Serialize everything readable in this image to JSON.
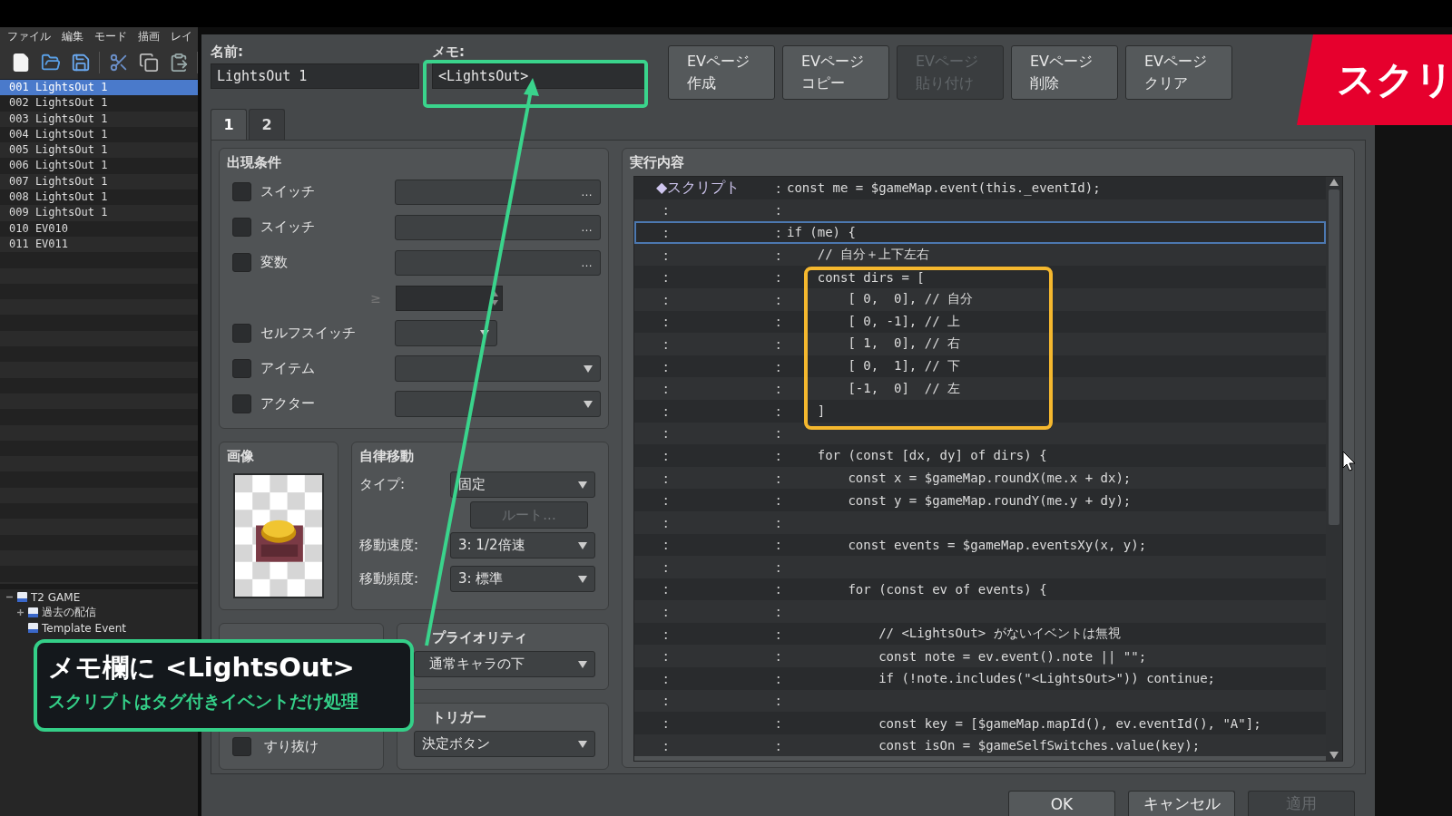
{
  "menu": [
    "ファイル",
    "編集",
    "モード",
    "描画",
    "レイ"
  ],
  "event_list": [
    {
      "text": "001 LightsOut 1",
      "selected": true
    },
    {
      "text": "002 LightsOut 1",
      "selected": false
    },
    {
      "text": "003 LightsOut 1",
      "selected": false
    },
    {
      "text": "004 LightsOut 1",
      "selected": false
    },
    {
      "text": "005 LightsOut 1",
      "selected": false
    },
    {
      "text": "006 LightsOut 1",
      "selected": false
    },
    {
      "text": "007 LightsOut 1",
      "selected": false
    },
    {
      "text": "008 LightsOut 1",
      "selected": false
    },
    {
      "text": "009 LightsOut 1",
      "selected": false
    },
    {
      "text": "010 EV010",
      "selected": false
    },
    {
      "text": "011 EV011",
      "selected": false
    }
  ],
  "tree": {
    "label": "T2 GAME",
    "expanded": true,
    "children": [
      {
        "label": "過去の配信",
        "expanded": false
      },
      {
        "label": "Template Event"
      }
    ]
  },
  "dialog": {
    "name_label": "名前:",
    "name_value": "LightsOut 1",
    "memo_label": "メモ:",
    "memo_value": "<LightsOut>",
    "page_buttons": [
      {
        "label": "EVページ作成",
        "disabled": false
      },
      {
        "label": "EVページコピー",
        "disabled": false
      },
      {
        "label": "EVページ貼り付け",
        "disabled": true
      },
      {
        "label": "EVページ削除",
        "disabled": false
      },
      {
        "label": "EVページクリア",
        "disabled": false
      }
    ],
    "tabs": [
      {
        "label": "1",
        "selected": true
      },
      {
        "label": "2",
        "selected": false
      }
    ],
    "conditions": {
      "title": "出現条件",
      "rows": [
        {
          "kind": "picker",
          "label": "スイッチ",
          "checked": false,
          "button": "…"
        },
        {
          "kind": "picker",
          "label": "スイッチ",
          "checked": false,
          "button": "…"
        },
        {
          "kind": "picker",
          "label": "変数",
          "checked": false,
          "button": "…"
        },
        {
          "kind": "compare",
          "symbol": "≥"
        },
        {
          "kind": "small-select",
          "label": "セルフスイッチ",
          "checked": false
        },
        {
          "kind": "select",
          "label": "アイテム",
          "checked": false
        },
        {
          "kind": "select",
          "label": "アクター",
          "checked": false
        }
      ]
    },
    "image": {
      "title": "画像"
    },
    "movement": {
      "title": "自律移動",
      "type_label": "タイプ:",
      "type_value": "固定",
      "route_button": {
        "label": "ルート...",
        "disabled": true
      },
      "speed_label": "移動速度:",
      "speed_value": "3: 1/2倍速",
      "freq_label": "移動頻度:",
      "freq_value": "3: 標準"
    },
    "options": {
      "rows": [
        {
          "label": "すり抜け",
          "checked": false
        }
      ]
    },
    "priority": {
      "title": "プライオリティ",
      "value": "通常キャラの下"
    },
    "trigger": {
      "title": "トリガー",
      "value": "決定ボタン"
    },
    "contents": {
      "title": "実行内容",
      "rows": [
        {
          "label": "◆スクリプト",
          "code": "const me = $gameMap.event(this._eventId);",
          "selected": false
        },
        {
          "label": ":",
          "code": "",
          "selected": false
        },
        {
          "label": ":",
          "code": "if (me) {",
          "selected": true
        },
        {
          "label": ":",
          "code": "    // 自分＋上下左右",
          "selected": false
        },
        {
          "label": ":",
          "code": "    const dirs = [",
          "selected": false
        },
        {
          "label": ":",
          "code": "        [ 0,  0], // 自分",
          "selected": false
        },
        {
          "label": ":",
          "code": "        [ 0, -1], // 上",
          "selected": false
        },
        {
          "label": ":",
          "code": "        [ 1,  0], // 右",
          "selected": false
        },
        {
          "label": ":",
          "code": "        [ 0,  1], // 下",
          "selected": false
        },
        {
          "label": ":",
          "code": "        [-1,  0]  // 左",
          "selected": false
        },
        {
          "label": ":",
          "code": "    ]",
          "selected": false
        },
        {
          "label": ":",
          "code": "",
          "selected": false
        },
        {
          "label": ":",
          "code": "    for (const [dx, dy] of dirs) {",
          "selected": false
        },
        {
          "label": ":",
          "code": "        const x = $gameMap.roundX(me.x + dx);",
          "selected": false
        },
        {
          "label": ":",
          "code": "        const y = $gameMap.roundY(me.y + dy);",
          "selected": false
        },
        {
          "label": ":",
          "code": "",
          "selected": false
        },
        {
          "label": ":",
          "code": "        const events = $gameMap.eventsXy(x, y);",
          "selected": false
        },
        {
          "label": ":",
          "code": "",
          "selected": false
        },
        {
          "label": ":",
          "code": "        for (const ev of events) {",
          "selected": false
        },
        {
          "label": ":",
          "code": "",
          "selected": false
        },
        {
          "label": ":",
          "code": "            // <LightsOut> がないイベントは無視",
          "selected": false
        },
        {
          "label": ":",
          "code": "            const note = ev.event().note || \"\";",
          "selected": false
        },
        {
          "label": ":",
          "code": "            if (!note.includes(\"<LightsOut>\")) continue;",
          "selected": false
        },
        {
          "label": ":",
          "code": "",
          "selected": false
        },
        {
          "label": ":",
          "code": "            const key = [$gameMap.mapId(), ev.eventId(), \"A\"];",
          "selected": false
        },
        {
          "label": ":",
          "code": "            const isOn = $gameSelfSwitches.value(key);",
          "selected": false
        }
      ]
    },
    "footer_buttons": [
      {
        "label": "OK",
        "disabled": false
      },
      {
        "label": "キャンセル",
        "disabled": false
      },
      {
        "label": "適用",
        "disabled": true
      }
    ]
  },
  "callout": {
    "title": "メモ欄に <LightsOut>",
    "subtitle": "スクリプトはタグ付きイベントだけ処理"
  },
  "banner": "スクリ"
}
